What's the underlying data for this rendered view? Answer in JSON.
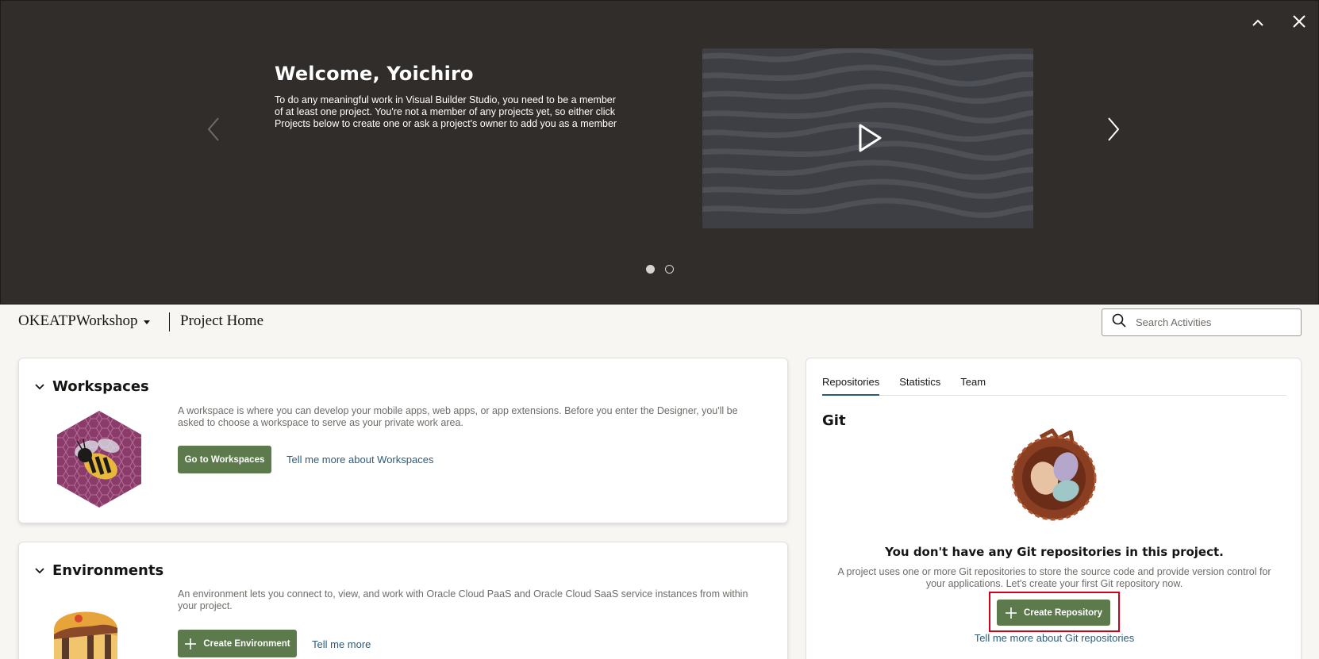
{
  "hero": {
    "title": "Welcome, Yoichiro",
    "text": "To do any meaningful work in Visual Builder Studio, you need to be a member of at least one project. You're not a member of any projects yet, so either click Projects below to create one or ask a project's owner to add you as a member",
    "slides_total": 2,
    "active_slide": 1,
    "icons": [
      "chevron-up-icon",
      "close-icon",
      "chevron-left-icon",
      "chevron-right-icon",
      "play-icon"
    ],
    "background_color": "#312d2a"
  },
  "project_bar": {
    "project_name": "OKEATPWorkshop",
    "page_title": "Project Home",
    "search_placeholder": "Search Activities"
  },
  "workspaces": {
    "title": "Workspaces",
    "description": "A workspace is where you can develop your mobile apps, web apps, or app extensions. Before you enter the Designer, you'll be asked to choose a workspace to serve as your private work area.",
    "button_label": "Go to Workspaces",
    "link_label": "Tell me more about Workspaces"
  },
  "environments": {
    "title": "Environments",
    "description": "An environment lets you connect to, view, and work with Oracle Cloud PaaS and Oracle Cloud SaaS service instances from within your project.",
    "button_label": "Create Environment",
    "link_label": "Tell me more"
  },
  "repositories": {
    "tabs": [
      {
        "label": "Repositories",
        "active": true
      },
      {
        "label": "Statistics",
        "active": false
      },
      {
        "label": "Team",
        "active": false
      }
    ],
    "section_title": "Git",
    "empty_title": "You don't have any Git repositories in this project.",
    "empty_description": "A project uses one or more Git repositories to store the source code and provide version control for your applications. Let's create your first Git repository now.",
    "button_label": "Create Repository",
    "link_label": "Tell me more about Git repositories"
  },
  "colors": {
    "accent_green": "#5d7a4c",
    "link_blue": "#2e5b7a",
    "highlight_red": "#d0021b"
  }
}
